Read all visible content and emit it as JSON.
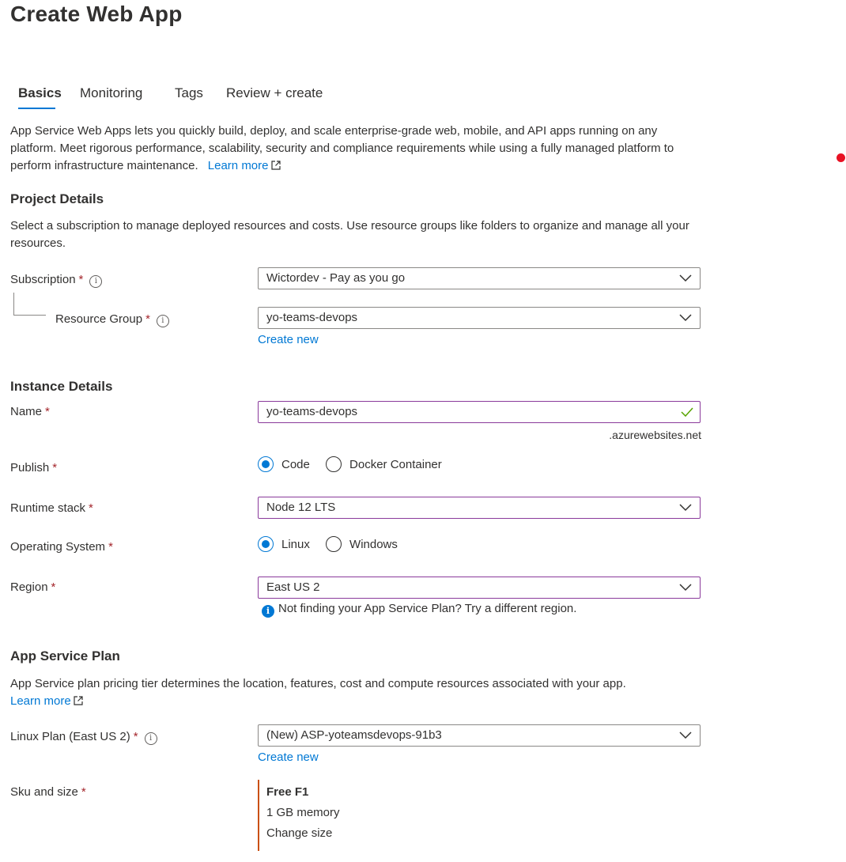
{
  "page": {
    "title": "Create Web App"
  },
  "tabs": [
    {
      "label": "Basics",
      "active": true
    },
    {
      "label": "Monitoring",
      "active": false
    },
    {
      "label": "Tags",
      "active": false
    },
    {
      "label": "Review + create",
      "active": false
    }
  ],
  "intro": {
    "text": "App Service Web Apps lets you quickly build, deploy, and scale enterprise-grade web, mobile, and API apps running on any platform. Meet rigorous performance, scalability, security and compliance requirements while using a fully managed platform to perform infrastructure maintenance.",
    "learn_more": "Learn more"
  },
  "project_details": {
    "heading": "Project Details",
    "description": "Select a subscription to manage deployed resources and costs. Use resource groups like folders to organize and manage all your resources.",
    "subscription": {
      "label": "Subscription",
      "value": "Wictordev - Pay as you go"
    },
    "resource_group": {
      "label": "Resource Group",
      "value": "yo-teams-devops",
      "create_new": "Create new"
    }
  },
  "instance_details": {
    "heading": "Instance Details",
    "name": {
      "label": "Name",
      "value": "yo-teams-devops",
      "suffix": ".azurewebsites.net"
    },
    "publish": {
      "label": "Publish",
      "options": [
        "Code",
        "Docker Container"
      ],
      "selected": "Code"
    },
    "runtime_stack": {
      "label": "Runtime stack",
      "value": "Node 12 LTS"
    },
    "operating_system": {
      "label": "Operating System",
      "options": [
        "Linux",
        "Windows"
      ],
      "selected": "Linux"
    },
    "region": {
      "label": "Region",
      "value": "East US 2",
      "hint": "Not finding your App Service Plan? Try a different region."
    }
  },
  "app_service_plan": {
    "heading": "App Service Plan",
    "description": "App Service plan pricing tier determines the location, features, cost and compute resources associated with your app.",
    "learn_more": "Learn more",
    "linux_plan": {
      "label": "Linux Plan (East US 2)",
      "value": "(New) ASP-yoteamsdevops-91b3",
      "create_new": "Create new"
    },
    "sku": {
      "label": "Sku and size",
      "tier": "Free F1",
      "memory": "1 GB memory",
      "change": "Change size"
    }
  },
  "required_marker": "*",
  "colors": {
    "accent": "#0078d4",
    "required": "#a4262c",
    "focus": "#8a3a9b",
    "sku_bar": "#ca5010",
    "success": "#57a300"
  }
}
